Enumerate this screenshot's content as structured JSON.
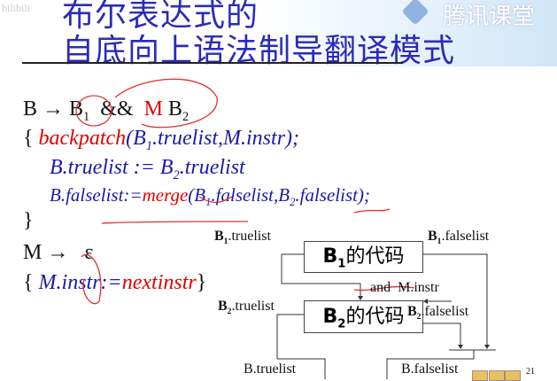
{
  "watermark": "bilibili",
  "title": {
    "line1": "布尔表达式的",
    "line2": "自底向上语法制导翻译模式"
  },
  "logo": "腾讯课堂",
  "code": {
    "l1": {
      "lhs": "B",
      "arrow": "→",
      "b1": "B",
      "b1sub": "1",
      "and": "&&",
      "m": "M",
      "b2": "B",
      "b2sub": "2"
    },
    "l2": {
      "brace": "{",
      "fn": "backpatch",
      "a": "(B",
      "asub": "1",
      "b": ".truelist,M.instr);"
    },
    "l3": {
      "a": "B.truelist := B",
      "sub": "2",
      "b": ".truelist"
    },
    "l4": {
      "a": "B.falselist:=",
      "fn": "merge",
      "b": "(B",
      "bsub": "1",
      "c": ".falselist,B",
      "csub": "2",
      "d": ".falselist);"
    },
    "l5": "}",
    "l6": {
      "m": "M",
      "arrow": "→",
      "eps": "ε"
    },
    "l7": {
      "brace": "{",
      "a": "M.instr:=",
      "fn": "nextinstr",
      "close": "}"
    }
  },
  "diagram": {
    "b1_truelist": {
      "b": "B",
      "sub": "1",
      "t": ".truelist"
    },
    "b1_falselist": {
      "b": "B",
      "sub": "1",
      "t": ".falselist"
    },
    "b1_box": {
      "b": "B",
      "sub": "1",
      "t": "的代码"
    },
    "and_minstr": "and  M.instr",
    "b2_truelist": {
      "b": "B",
      "sub": "2",
      "t": ".truelist"
    },
    "b2_falselist": {
      "b": "B",
      "sub": "2",
      "t": ".falselist"
    },
    "b2_box": {
      "b": "B",
      "sub": "2",
      "t": "的代码"
    },
    "b_truelist": "B.truelist",
    "b_falselist": "B.falselist"
  },
  "page_number": "21"
}
